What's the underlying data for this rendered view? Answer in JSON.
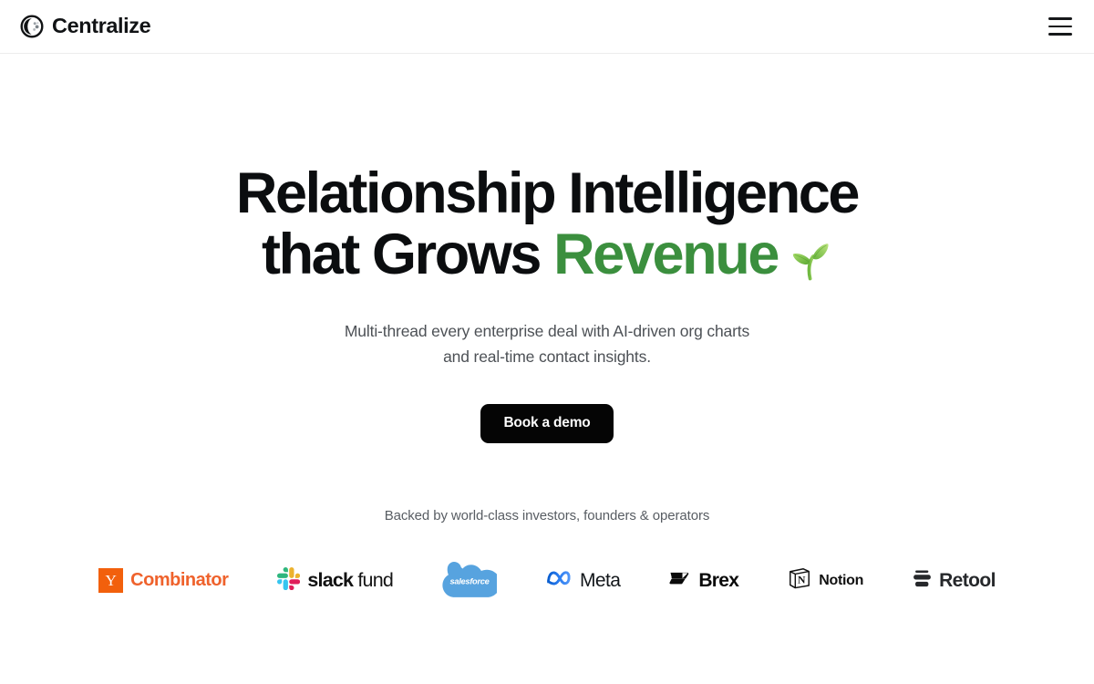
{
  "header": {
    "brand_name": "Centralize",
    "logo_icon": "centralize-globe-icon",
    "menu_icon": "hamburger-menu-icon"
  },
  "hero": {
    "headline_line1": "Relationship Intelligence",
    "headline_line2_plain": "that Grows ",
    "headline_line2_accent": "Revenue",
    "headline_emoji": "seedling-emoji",
    "accent_color": "#3b8f3e",
    "subhead_line1": "Multi-thread every enterprise deal with AI-driven org charts",
    "subhead_line2": "and real-time contact insights.",
    "cta_label": "Book a demo",
    "cta_background": "#050505"
  },
  "social_proof": {
    "caption": "Backed by world-class investors, founders & operators",
    "logos": [
      {
        "name": "Y Combinator",
        "mark": "yc-square-icon",
        "letter": "Y",
        "text": "Combinator",
        "color": "#ef622c"
      },
      {
        "name": "slack fund",
        "mark": "slack-hash-icon",
        "text_bold": "slack",
        "text_light": "fund"
      },
      {
        "name": "salesforce",
        "mark": "salesforce-cloud-icon",
        "text": "salesforce",
        "color": "#57a3df"
      },
      {
        "name": "Meta",
        "mark": "meta-infinity-icon",
        "text": "Meta",
        "color": "#1f6fe0"
      },
      {
        "name": "Brex",
        "mark": "brex-mark-icon",
        "text": "Brex",
        "color": "#0a0a0a"
      },
      {
        "name": "Notion",
        "mark": "notion-cube-icon",
        "text": "Notion",
        "color": "#111111"
      },
      {
        "name": "Retool",
        "mark": "retool-bars-icon",
        "text": "Retool",
        "color": "#26282b"
      }
    ]
  }
}
